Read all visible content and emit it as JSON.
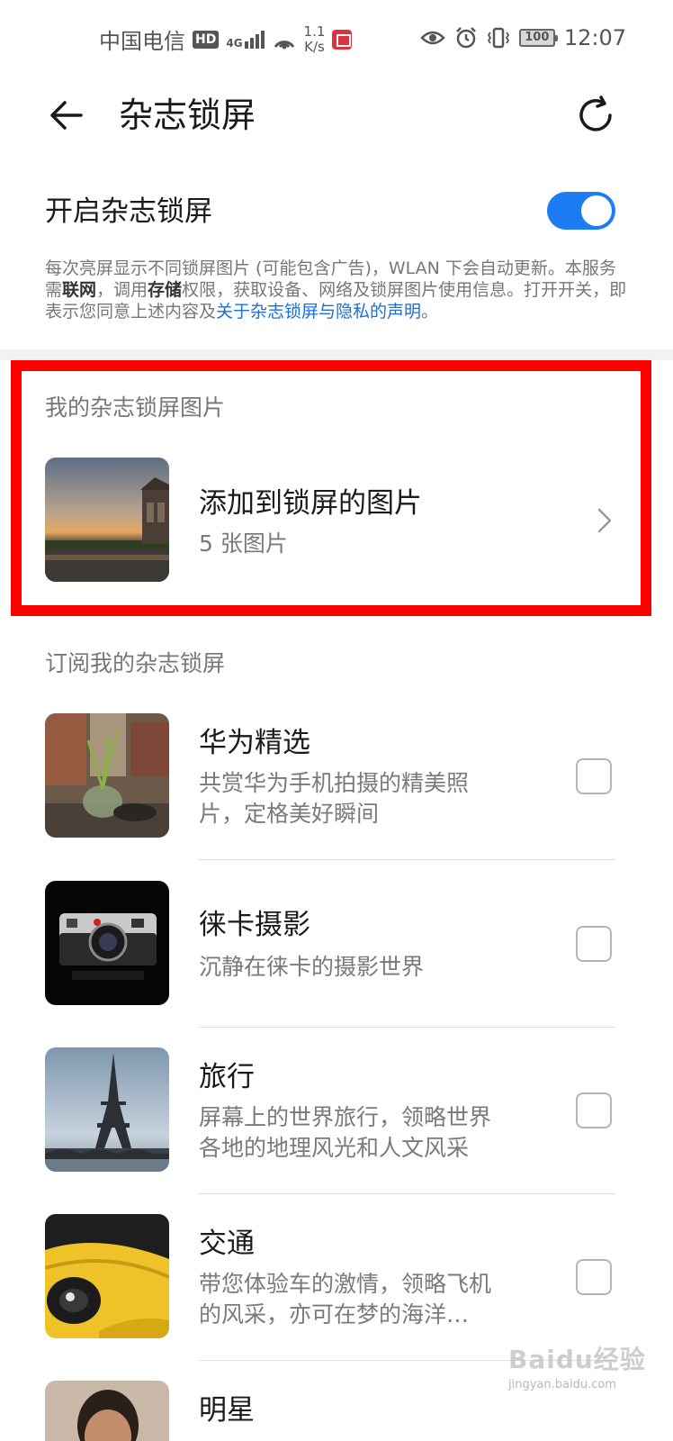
{
  "status_bar": {
    "carrier": "中国电信",
    "hd": "HD",
    "network": "4G",
    "speed_value": "1.1",
    "speed_unit": "K/s",
    "battery": "100",
    "time": "12:07"
  },
  "header": {
    "title": "杂志锁屏",
    "back_icon": "arrow-left",
    "refresh_icon": "refresh"
  },
  "toggle": {
    "label": "开启杂志锁屏",
    "on": true,
    "accent": "#1c7cf4"
  },
  "description": {
    "part1": "每次亮屏显示不同锁屏图片 (可能包含广告)，WLAN 下会自动更新。本服务需",
    "bold1": "联网",
    "part2": "，调用",
    "bold2": "存储",
    "part3": "权限，获取设备、网络及锁屏图片使用信息。打开开关，即表示您同意上述内容及",
    "link": "关于杂志锁屏与隐私的声明",
    "part4": "。"
  },
  "my_pictures": {
    "section_title": "我的杂志锁屏图片",
    "item_title": "添加到锁屏的图片",
    "item_count": "5 张图片"
  },
  "subscriptions": {
    "section_title": "订阅我的杂志锁屏",
    "items": [
      {
        "title": "华为精选",
        "desc_line1": "共赏华为手机拍摄的精美照",
        "desc_line2": "片，定格美好瞬间",
        "checked": false
      },
      {
        "title": "徕卡摄影",
        "desc_line1": "沉静在徕卡的摄影世界",
        "desc_line2": "",
        "checked": false
      },
      {
        "title": "旅行",
        "desc_line1": "屏幕上的世界旅行，领略世界",
        "desc_line2": "各地的地理风光和人文风采",
        "checked": false
      },
      {
        "title": "交通",
        "desc_line1": "带您体验车的激情，领略飞机",
        "desc_line2": "的风采，亦可在梦的海洋…",
        "checked": false
      },
      {
        "title": "明星",
        "desc_line1": "",
        "desc_line2": "",
        "checked": false
      }
    ]
  },
  "watermark": {
    "text": "Baidu经验",
    "url": "jingyan.baidu.com"
  },
  "colors": {
    "highlight": "#ff0000",
    "link": "#1c6fd8"
  }
}
